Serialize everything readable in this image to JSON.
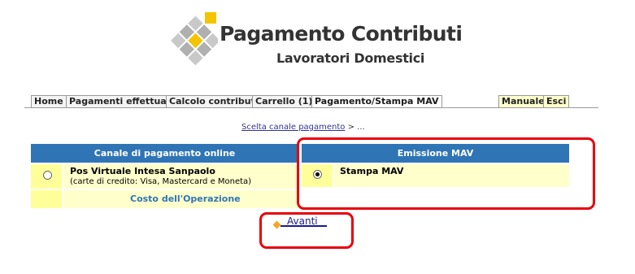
{
  "logo": {
    "title": "Pagamento Contributi",
    "subtitle": "Lavoratori Domestici"
  },
  "nav": {
    "tabs": [
      "Home",
      "Pagamenti effettuati",
      "Calcolo contributi",
      "Carrello (1)",
      "Pagamento/Stampa MAV"
    ],
    "right_tabs": [
      "Manuale",
      "Esci"
    ],
    "active_tab": "Pagamento/Stampa MAV"
  },
  "breadcrumb": {
    "link": "Scelta canale pagamento",
    "rest": " > ..."
  },
  "online": {
    "header": "Canale di pagamento online",
    "option_title": "Pos Virtuale Intesa Sanpaolo",
    "option_subtitle": "(carte di credito: Visa, Mastercard e Moneta)",
    "option_selected": false,
    "cost_link": "Costo dell'Operazione"
  },
  "mav": {
    "header": "Emissione MAV",
    "option_title": "Stampa MAV",
    "option_selected": true
  },
  "avanti": {
    "label": "Avanti"
  },
  "colors": {
    "header_blue": "#2f75b5",
    "row_yellow": "#ffffcc",
    "radio_cell_yellow": "#ffff99",
    "annotation_red": "#e8000b",
    "logo_orange": "#f5a623"
  }
}
